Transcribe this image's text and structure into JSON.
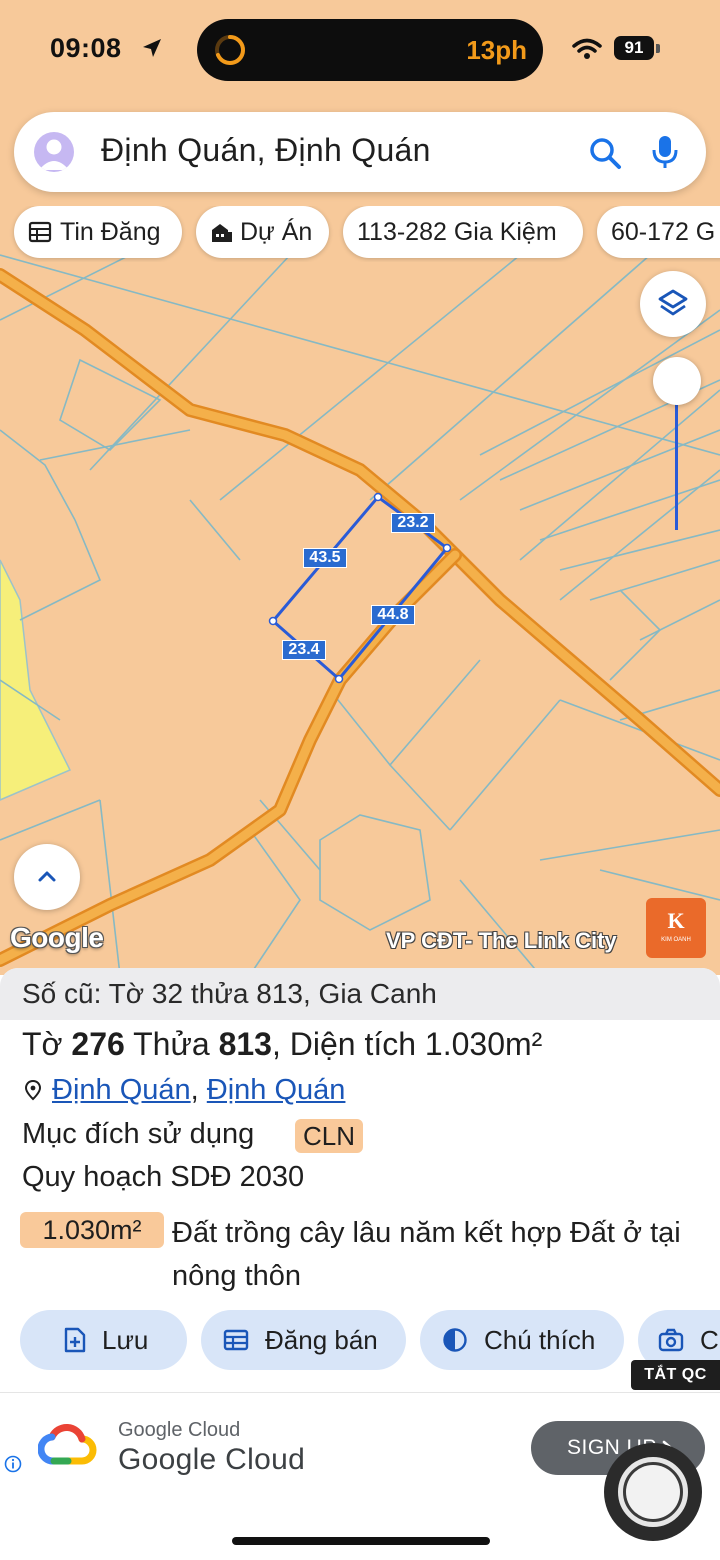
{
  "status_bar": {
    "time": "09:08",
    "island_text": "13ph",
    "battery": "91"
  },
  "search": {
    "value": "Định Quán, Định Quán"
  },
  "chips": [
    "Tin Đăng",
    "Dự Án",
    "113-282 Gia Kiệm",
    "60-172 G"
  ],
  "map": {
    "measurements": [
      "23.2",
      "43.5",
      "44.8",
      "23.4"
    ],
    "google_label": "Google",
    "credit": "VP CĐT- The Link City",
    "badge_letter": "K",
    "badge_sub": "KIM OANH",
    "background_color": "#f7c99a",
    "road_color": "#f1a235",
    "parcel_outline_color": "#2a5bd7"
  },
  "sheet": {
    "old_ref": "Số cũ: Tờ 32 thửa 813, Gia Canh",
    "title": {
      "to_label": "Tờ",
      "to_value": "276",
      "thua_label": "Thửa",
      "thua_value": "813",
      "area_label": "Diện tích",
      "area_value": "1.030m²"
    },
    "address": {
      "district": "Định Quán",
      "separator": ",",
      "town": "Định Quán"
    },
    "usage_label": "Mục đích sử dụng",
    "usage_code": "CLN",
    "plan_label": "Quy hoạch SDĐ 2030",
    "area_tag": "1.030m²",
    "area_desc": "Đất trồng cây lâu năm kết hợp Đất ở tại nông thôn",
    "actions": [
      "Lưu",
      "Đăng bán",
      "Chú thích",
      "C"
    ],
    "ads_off": "TẮT QC"
  },
  "ad": {
    "brand": "Google Cloud",
    "title": "Google Cloud",
    "button": "SIGN UP"
  }
}
